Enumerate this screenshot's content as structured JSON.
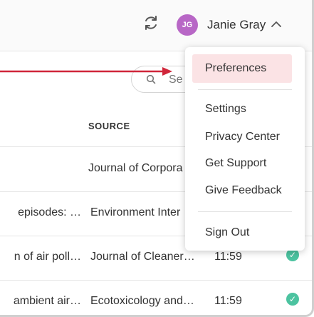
{
  "header": {
    "user_initials": "JG",
    "user_name": "Janie Gray",
    "avatar_color": "#b867c6"
  },
  "search": {
    "placeholder": "Se"
  },
  "table": {
    "column_source": "SOURCE",
    "rows": [
      {
        "title": "",
        "source": "Journal of Corpora",
        "time": "",
        "status": false
      },
      {
        "title": "episodes: …",
        "source": "Environment Inter",
        "time": "",
        "status": false
      },
      {
        "title": "n of air poll…",
        "source": "Journal of Cleaner…",
        "time": "11:59",
        "status": true
      },
      {
        "title": "ambient air…",
        "source": "Ecotoxicology and…",
        "time": "11:59",
        "status": true
      }
    ]
  },
  "menu": {
    "items": [
      "Preferences",
      "Settings",
      "Privacy Center",
      "Get Support",
      "Give Feedback",
      "Sign Out"
    ],
    "active_index": 0,
    "active_color": "#fbe3e5"
  },
  "annotation": {
    "arrow_color": "#d0263a"
  },
  "status_color": "#4cc3a0"
}
